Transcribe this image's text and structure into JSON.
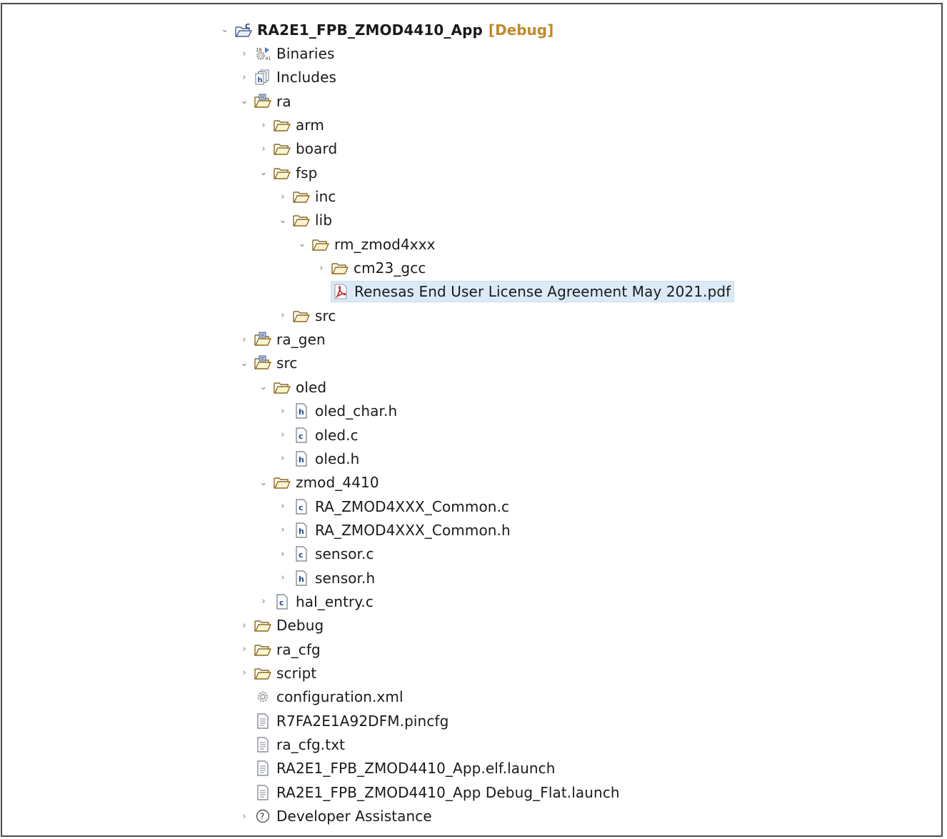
{
  "tree": {
    "project": {
      "label": "RA2E1_FPB_ZMOD4410_App",
      "suffix": "[Debug]"
    },
    "binaries": "Binaries",
    "includes": "Includes",
    "ra": "ra",
    "arm": "arm",
    "board": "board",
    "fsp": "fsp",
    "inc": "inc",
    "lib": "lib",
    "rm_zmod4xxx": "rm_zmod4xxx",
    "cm23_gcc": "cm23_gcc",
    "license_pdf": "Renesas End User License Agreement May 2021.pdf",
    "fsp_src": "src",
    "ra_gen": "ra_gen",
    "src": "src",
    "oled": "oled",
    "oled_char_h": "oled_char.h",
    "oled_c": "oled.c",
    "oled_h": "oled.h",
    "zmod_4410": "zmod_4410",
    "common_c": "RA_ZMOD4XXX_Common.c",
    "common_h": "RA_ZMOD4XXX_Common.h",
    "sensor_c": "sensor.c",
    "sensor_h": "sensor.h",
    "hal_entry_c": "hal_entry.c",
    "debug": "Debug",
    "ra_cfg": "ra_cfg",
    "script": "script",
    "configuration_xml": "configuration.xml",
    "pincfg": "R7FA2E1A92DFM.pincfg",
    "ra_cfg_txt": "ra_cfg.txt",
    "elf_launch": "RA2E1_FPB_ZMOD4410_App.elf.launch",
    "debug_flat_launch": "RA2E1_FPB_ZMOD4410_App Debug_Flat.launch",
    "developer_assistance": "Developer Assistance"
  },
  "colors": {
    "selection": "#dceaf8",
    "debug_suffix": "#c08a2a",
    "folder": "#e8b84a",
    "pdf": "#c0262e"
  },
  "icons": {
    "expanded": "chevron-down-icon",
    "collapsed": "chevron-right-icon",
    "folder": "folder-icon",
    "source_folder": "source-folder-icon",
    "c_file": "c-file-icon",
    "h_file": "h-file-icon",
    "pdf": "pdf-icon",
    "text_file": "text-file-icon",
    "gear": "gear-icon",
    "help": "help-icon"
  }
}
